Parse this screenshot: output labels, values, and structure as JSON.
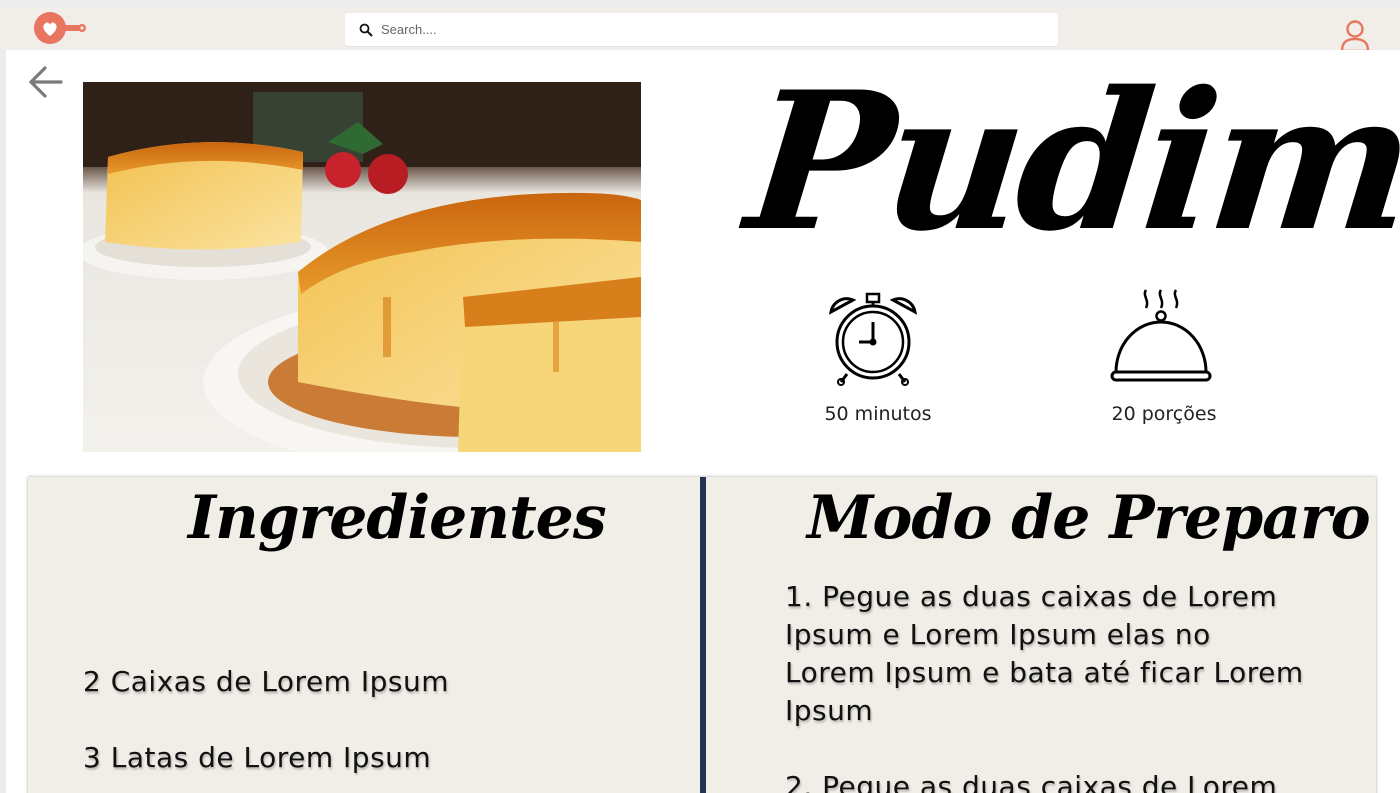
{
  "header": {
    "search_placeholder": "Search....",
    "logo_icon": "heart-pan-logo",
    "user_icon": "user-icon",
    "accent_color": "#e8755f"
  },
  "recipe": {
    "title": "Pudim",
    "image_alt": "pudim-photo",
    "time": {
      "icon": "alarm-clock-icon",
      "label": "50 minutos"
    },
    "servings": {
      "icon": "serving-cloche-icon",
      "label": "20 porções"
    }
  },
  "ingredients": {
    "title": "Ingredientes",
    "items": [
      "2 Caixas de Lorem Ipsum",
      "3 Latas de Lorem Ipsum"
    ]
  },
  "preparation": {
    "title": "Modo de Preparo",
    "steps": [
      "1. Pegue as duas caixas de Lorem Ipsum e Lorem Ipsum elas no Lorem Ipsum e bata até ficar Lorem Ipsum",
      "2. Pegue as duas caixas de Lorem"
    ]
  }
}
